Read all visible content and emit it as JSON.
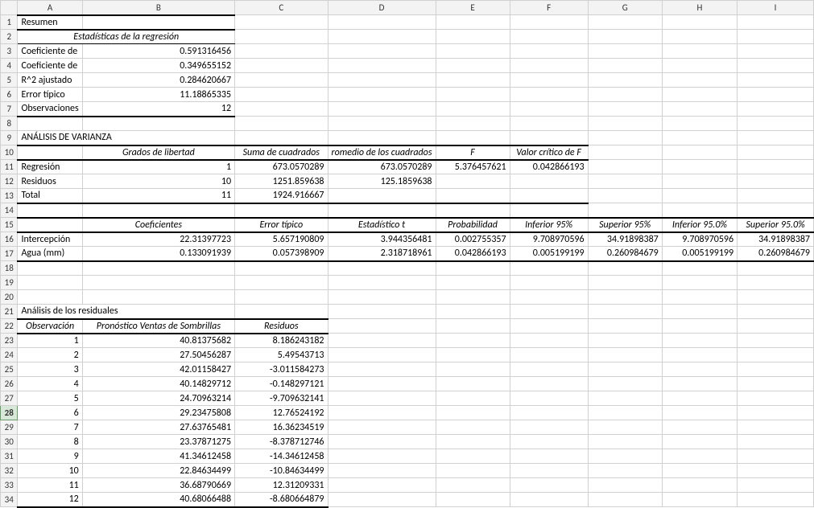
{
  "cols": [
    "",
    "A",
    "B",
    "C",
    "D",
    "E",
    "F",
    "G",
    "H",
    "I"
  ],
  "rows": {
    "1": {
      "A": "Resumen"
    },
    "2": {
      "merged": "Estadísticas de la regresión"
    },
    "3": {
      "A": "Coeficiente de",
      "B": "0.591316456"
    },
    "4": {
      "A": "Coeficiente de",
      "B": "0.349655152"
    },
    "5": {
      "A": "R^2  ajustado",
      "B": "0.284620667"
    },
    "6": {
      "A": "Error típico",
      "B": "11.18865335"
    },
    "7": {
      "A": "Observaciones",
      "B": "12"
    },
    "9": {
      "A": "ANÁLISIS DE VARIANZA"
    },
    "10": {
      "B": "Grados de libertad",
      "C": "Suma de cuadrados",
      "D": "romedio de los cuadrados",
      "E": "F",
      "F": "Valor crítico de F"
    },
    "11": {
      "A": "Regresión",
      "B": "1",
      "C": "673.0570289",
      "D": "673.0570289",
      "E": "5.376457621",
      "F": "0.042866193"
    },
    "12": {
      "A": "Residuos",
      "B": "10",
      "C": "1251.859638",
      "D": "125.1859638"
    },
    "13": {
      "A": "Total",
      "B": "11",
      "C": "1924.916667"
    },
    "15": {
      "B": "Coeficientes",
      "C": "Error típico",
      "D": "Estadístico t",
      "E": "Probabilidad",
      "F": "Inferior 95%",
      "G": "Superior 95%",
      "H": "Inferior 95.0%",
      "I": "Superior 95.0%"
    },
    "16": {
      "A": "Intercepción",
      "B": "22.31397723",
      "C": "5.657190809",
      "D": "3.944356481",
      "E": "0.002755357",
      "F": "9.708970596",
      "G": "34.91898387",
      "H": "9.708970596",
      "I": "34.91898387"
    },
    "17": {
      "A": "Agua (mm)",
      "B": "0.133091939",
      "C": "0.057398909",
      "D": "2.318718961",
      "E": "0.042866193",
      "F": "0.005199199",
      "G": "0.260984679",
      "H": "0.005199199",
      "I": "0.260984679"
    },
    "21": {
      "A": "Análisis de los residuales"
    },
    "22": {
      "A": "Observación",
      "B": "Pronóstico Ventas de Sombrillas",
      "C": "Residuos"
    },
    "23": {
      "A": "1",
      "B": "40.81375682",
      "C": "8.186243182"
    },
    "24": {
      "A": "2",
      "B": "27.50456287",
      "C": "5.49543713"
    },
    "25": {
      "A": "3",
      "B": "42.01158427",
      "C": "-3.011584273"
    },
    "26": {
      "A": "4",
      "B": "40.14829712",
      "C": "-0.148297121"
    },
    "27": {
      "A": "5",
      "B": "24.70963214",
      "C": "-9.709632141"
    },
    "28": {
      "A": "6",
      "B": "29.23475808",
      "C": "12.76524192"
    },
    "29": {
      "A": "7",
      "B": "27.63765481",
      "C": "16.36234519"
    },
    "30": {
      "A": "8",
      "B": "23.37871275",
      "C": "-8.378712746"
    },
    "31": {
      "A": "9",
      "B": "41.34612458",
      "C": "-14.34612458"
    },
    "32": {
      "A": "10",
      "B": "22.84634499",
      "C": "-10.84634499"
    },
    "33": {
      "A": "11",
      "B": "36.68790669",
      "C": "12.31209331"
    },
    "34": {
      "A": "12",
      "B": "40.68066488",
      "C": "-8.680664879"
    }
  }
}
